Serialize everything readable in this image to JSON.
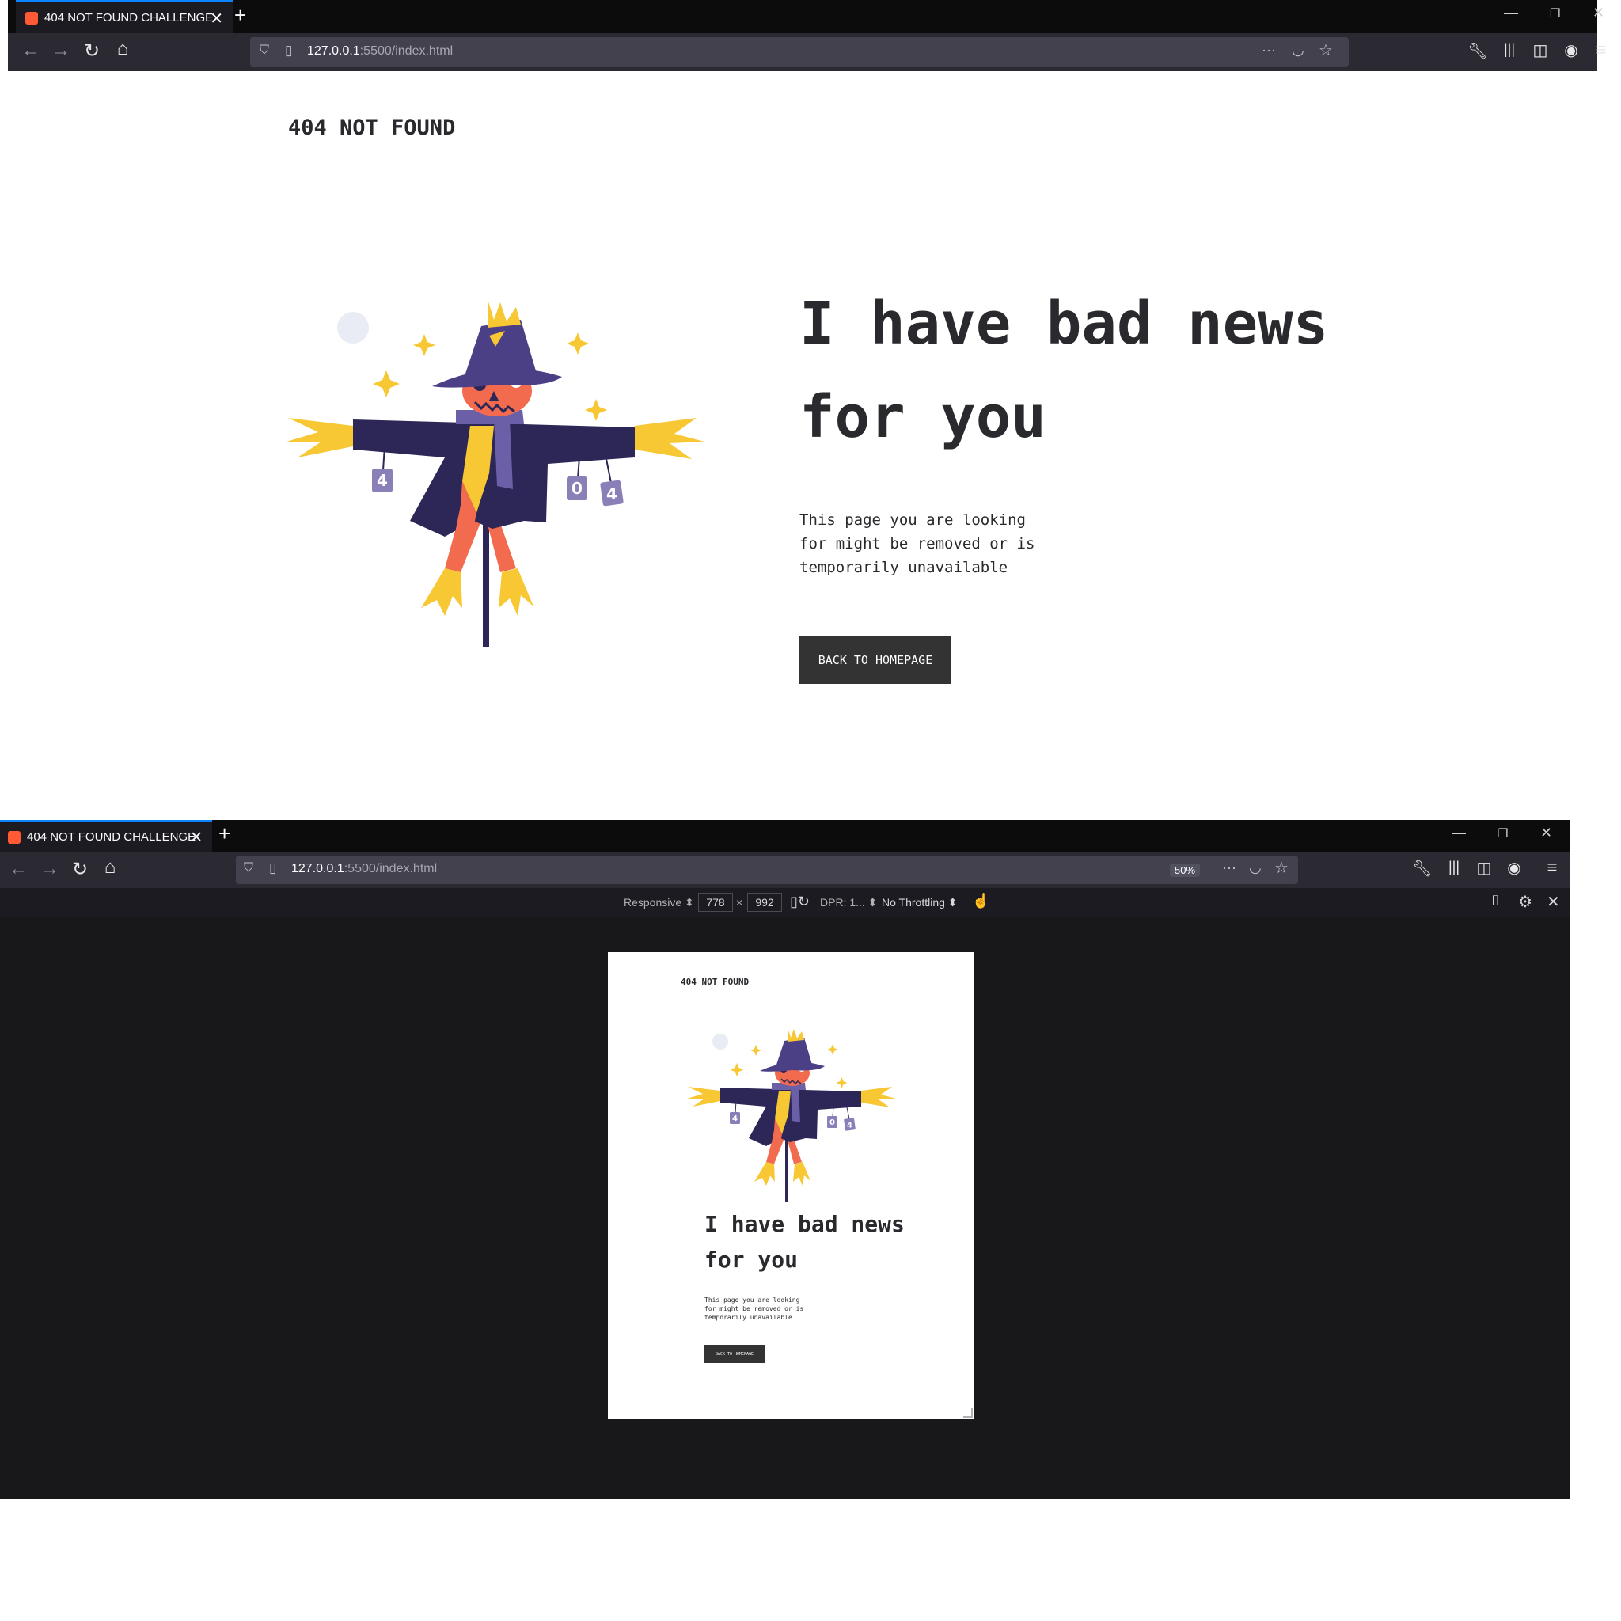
{
  "top_window": {
    "tab_title": "404 NOT FOUND CHALLENGE",
    "url_host": "127.0.0.1",
    "url_rest": ":5500/index.html",
    "overflow_icon": "···"
  },
  "bottom_window": {
    "tab_title": "404 NOT FOUND CHALLENGE",
    "url_host": "127.0.0.1",
    "url_rest": ":5500/index.html",
    "zoom": "50%",
    "overflow_icon": "···",
    "rdm": {
      "device": "Responsive ⬍",
      "width": "778",
      "times": "×",
      "height": "992",
      "dpr": "DPR: 1... ⬍",
      "throttling": "No Throttling ⬍"
    }
  },
  "page": {
    "logo": "404 NOT FOUND",
    "heading_line1": "I have bad news",
    "heading_line2": "for you",
    "message": "This page you are looking\nfor might be removed or is\ntemporarily unavailable",
    "button_label": "BACK TO HOMEPAGE",
    "can_labels": [
      "4",
      "0",
      "4"
    ]
  },
  "colors": {
    "browser_dark": "#0c0c0d",
    "toolbar": "#2b2a33",
    "urlbar": "#42414d",
    "tab_accent": "#0a84ff",
    "text_dark": "#2a2a2e",
    "button_bg": "#333333",
    "scarecrow_purple": "#2c2757",
    "hat_purple": "#4b3f86",
    "pumpkin": "#f26b4f",
    "straw": "#f7c834",
    "can_purple": "#8b7fb8"
  }
}
